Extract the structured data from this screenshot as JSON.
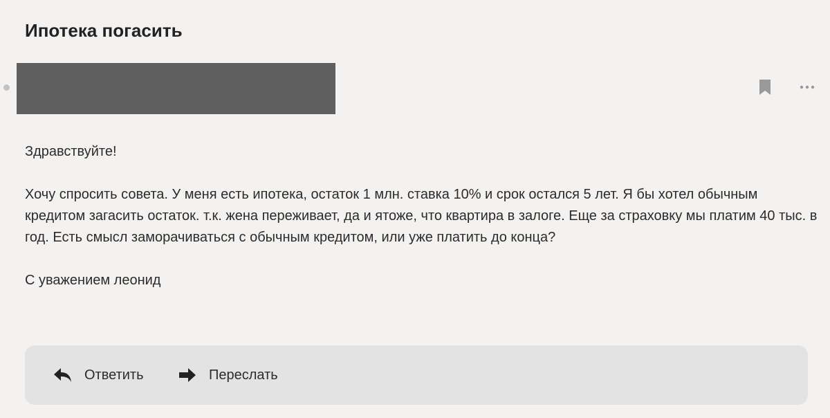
{
  "message": {
    "subject": "Ипотека погасить",
    "body": {
      "greeting": "Здравствуйте!",
      "paragraph": "Хочу спросить совета. У меня есть ипотека, остаток 1 млн. ставка 10% и срок остался 5 лет. Я бы хотел обычным кредитом загасить остаток. т.к. жена переживает, да и ятоже, что квартира в залоге. Еще за страховку мы платим 40 тыс. в год. Есть смысл заморачиваться с обычным кредитом, или уже платить до конца?",
      "signature": "С уважением леонид"
    }
  },
  "header": {
    "icons": [
      "bookmark-icon",
      "more-icon"
    ]
  },
  "actions": {
    "reply_label": "Ответить",
    "forward_label": "Переслать"
  },
  "colors": {
    "background": "#f3f2f1",
    "action_bar": "#e4e3e3",
    "redaction": "#5f5f5f",
    "icon": "#9a9a9a"
  }
}
